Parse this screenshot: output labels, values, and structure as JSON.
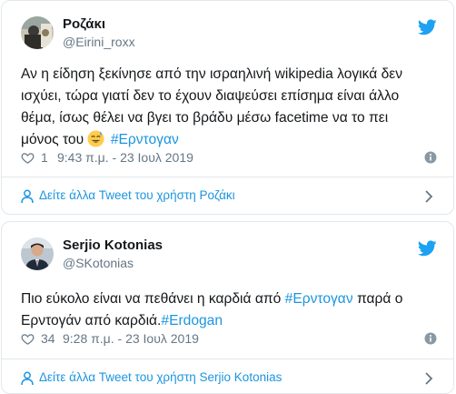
{
  "tweets": [
    {
      "author_name": "Ροζάκι",
      "handle": "@Eirini_roxx",
      "text_line1": "Αν η είδηση ξεκίνησε από την ισραηλινή wikipedia λογικά δεν",
      "text_line2": "ισχύει, τώρα γιατί δεν το έχουν διαψεύσει επίσημα είναι άλλο",
      "text_line3": "θέμα, ίσως θέλει να βγει το βράδυ μέσω facetime να το πει",
      "text_line4_prefix": "μόνος του",
      "emoji": "sweat-smile-emoji",
      "hashtag": "#Ερντογαν",
      "likes": "1",
      "timestamp": "9:43 π.μ. - 23 Ιουλ 2019",
      "footer_link": "Δείτε άλλα Tweet του χρήστη Ροζάκι"
    },
    {
      "author_name": "Serjio Kotonias",
      "handle": "@SKotonias",
      "text_line1_prefix": "Πιο εύκολο είναι να πεθάνει η καρδιά από",
      "hashtag_1": "#Ερντογαν",
      "text_line1_suffix": "παρά ο",
      "text_line2_prefix": "Ερντογάν από καρδιά.",
      "hashtag_2": "#Erdogan",
      "likes": "34",
      "timestamp": "9:28 π.μ. - 23 Ιουλ 2019",
      "footer_link": "Δείτε άλλα Tweet του χρήστη Serjio Kotonias"
    }
  ],
  "icons": {
    "brand": "twitter-bird-icon",
    "like": "heart-icon",
    "info": "info-icon",
    "profile": "person-icon",
    "more": "chevron-right-icon"
  },
  "colors": {
    "twitter_blue": "#1da1f2",
    "link_blue": "#1b95e0",
    "secondary_text": "#657786",
    "border": "#e1e8ed",
    "primary_text": "#14171a"
  }
}
